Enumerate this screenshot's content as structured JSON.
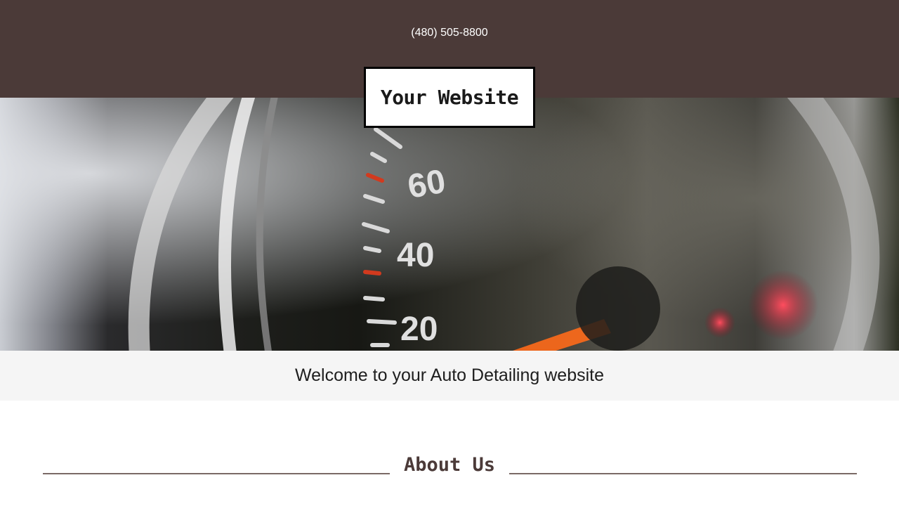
{
  "header": {
    "phone": "(480) 505-8800",
    "logo_text": "Your Website",
    "background_color": "#4b3a38"
  },
  "hero": {
    "gauge_labels": [
      "20",
      "40",
      "60"
    ]
  },
  "welcome": {
    "text": "Welcome to your Auto Detailing website"
  },
  "about": {
    "title": "About Us"
  }
}
